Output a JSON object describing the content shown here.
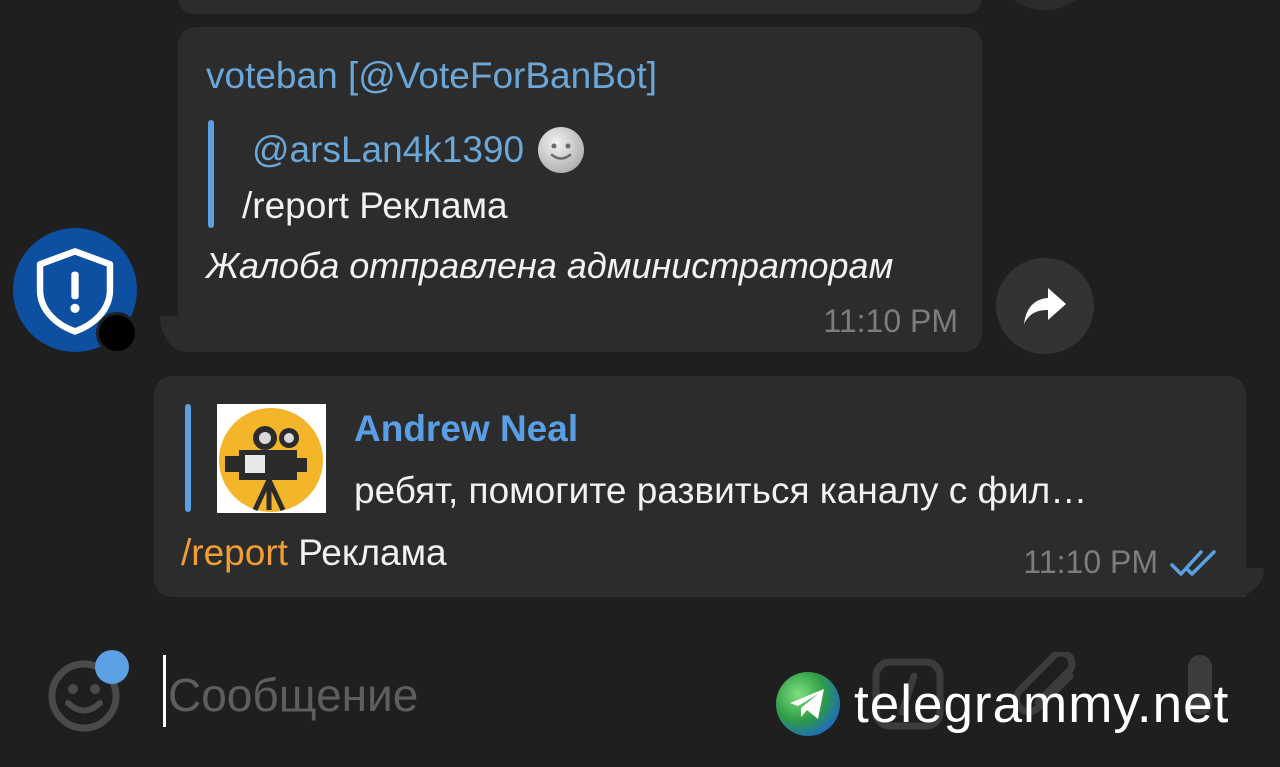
{
  "incoming_message": {
    "sender": "voteban [@VoteForBanBot]",
    "quote": {
      "mention": "@arsLan4k1390",
      "emoji_icon": "moon-face-icon",
      "text": "/report Реклама"
    },
    "body": "Жалоба отправлена администраторам",
    "time": "11:10 PM"
  },
  "outgoing_message": {
    "reply": {
      "author": "Andrew Neal",
      "text": "ребят, помогите развиться каналу с фил…",
      "thumbnail_icon": "film-camera-icon"
    },
    "command": "/report",
    "text": " Реклама",
    "time": "11:10 PM",
    "status_icon": "double-check-icon"
  },
  "composer": {
    "placeholder": "Сообщение",
    "value": ""
  },
  "watermark": {
    "text": "telegrammy.net"
  },
  "colors": {
    "background": "#1f1f1f",
    "bubble": "#2c2c2c",
    "link_blue": "#6ba7d8",
    "accent_blue": "#5aa0e2",
    "command_orange": "#f0a033",
    "time_gray": "#7d7d7d",
    "avatar_blue": "#0d4fa0"
  }
}
